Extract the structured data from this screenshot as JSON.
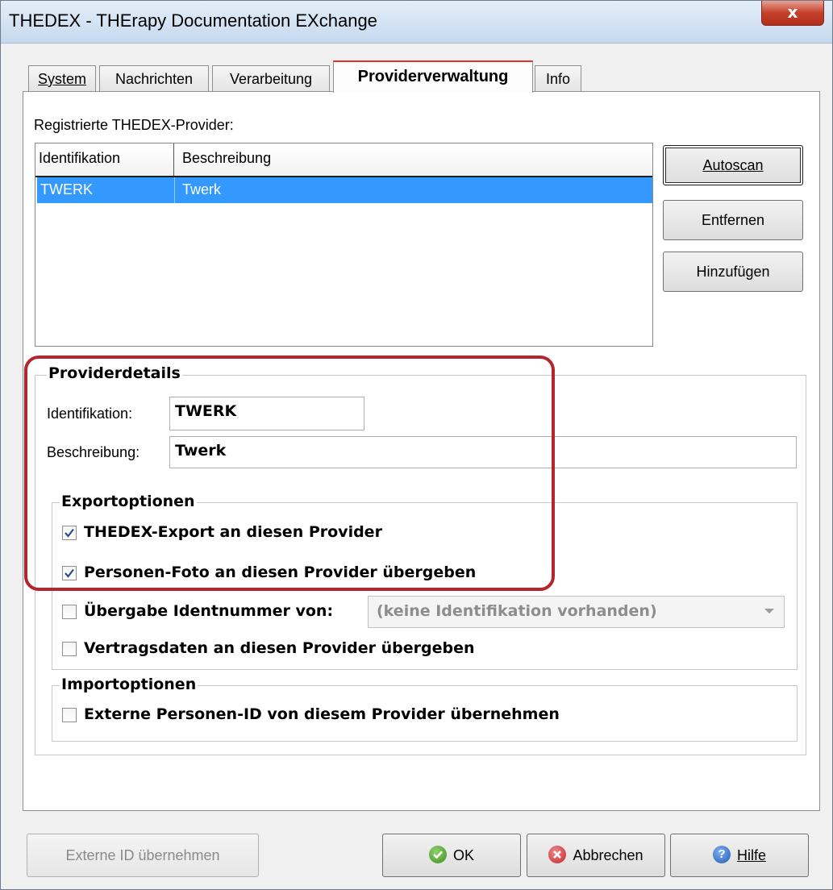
{
  "window": {
    "title": "THEDEX - THErapy Documentation EXchange",
    "close_glyph": "x"
  },
  "tabs": [
    {
      "label": "System",
      "accel": "S"
    },
    {
      "label": "Nachrichten",
      "accel": "N"
    },
    {
      "label": "Verarbeitung",
      "accel": "V"
    },
    {
      "label": "Providerverwaltung",
      "accel": "P",
      "active": true
    },
    {
      "label": "Info",
      "accel": "I"
    }
  ],
  "provider_list": {
    "label": "Registrierte THEDEX-Provider:",
    "columns": [
      "Identifikation",
      "Beschreibung"
    ],
    "rows": [
      {
        "id": "TWERK",
        "description": "Twerk",
        "selected": true
      }
    ]
  },
  "side_buttons": {
    "autoscan": "Autoscan",
    "remove": "Entfernen",
    "add": "Hinzufügen"
  },
  "details": {
    "group_title": "Providerdetails",
    "id_label": "Identifikation:",
    "id_value": "TWERK",
    "desc_label": "Beschreibung:",
    "desc_value": "Twerk"
  },
  "export_options": {
    "group_title": "Exportoptionen",
    "export": {
      "label": "THEDEX-Export an diesen Provider",
      "checked": true
    },
    "photo": {
      "label": "Personen-Foto an diesen Provider übergeben",
      "checked": true
    },
    "ident": {
      "label": "Übergabe Identnummer von:",
      "checked": false
    },
    "ident_combo": "(keine Identifikation vorhanden)",
    "contract": {
      "label": "Vertragsdaten an diesen Provider übergeben",
      "checked": false
    }
  },
  "import_options": {
    "group_title": "Importoptionen",
    "external_id": {
      "label": "Externe Personen-ID von diesem Provider übernehmen",
      "checked": false
    }
  },
  "footer": {
    "external_id_button": "Externe ID übernehmen",
    "ok": "OK",
    "cancel": "Abbrechen",
    "help": "Hilfe"
  },
  "colors": {
    "selection": "#3399ff",
    "highlight": "#b3262d",
    "active_tab_accent": "#e3312b"
  }
}
